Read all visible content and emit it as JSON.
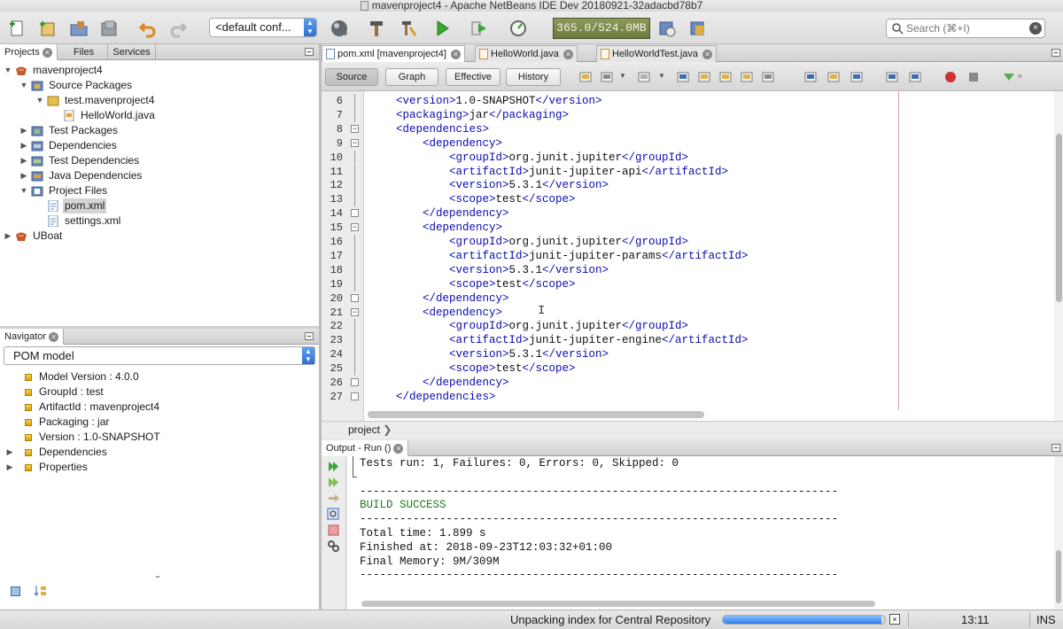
{
  "window": {
    "title": "mavenproject4 - Apache NetBeans IDE Dev 20180921-32adacbd78b7"
  },
  "toolbar": {
    "config_value": "<default conf...",
    "memory_label": "365.0/524.0MB",
    "search_placeholder": "Search (⌘+I)"
  },
  "projects_panel": {
    "tabs": [
      {
        "label": "Projects",
        "active": true
      },
      {
        "label": "Files",
        "active": false
      },
      {
        "label": "Services",
        "active": false
      }
    ],
    "tree": [
      {
        "label": "mavenproject4",
        "level": 0,
        "expanded": true,
        "icon": "maven-project-icon"
      },
      {
        "label": "Source Packages",
        "level": 1,
        "expanded": true,
        "icon": "source-packages-icon"
      },
      {
        "label": "test.mavenproject4",
        "level": 2,
        "expanded": true,
        "icon": "package-icon"
      },
      {
        "label": "HelloWorld.java",
        "level": 3,
        "expanded": null,
        "icon": "java-file-icon"
      },
      {
        "label": "Test Packages",
        "level": 1,
        "expanded": false,
        "icon": "test-packages-icon"
      },
      {
        "label": "Dependencies",
        "level": 1,
        "expanded": false,
        "icon": "dependencies-icon"
      },
      {
        "label": "Test Dependencies",
        "level": 1,
        "expanded": false,
        "icon": "test-dependencies-icon"
      },
      {
        "label": "Java Dependencies",
        "level": 1,
        "expanded": false,
        "icon": "java-dependencies-icon"
      },
      {
        "label": "Project Files",
        "level": 1,
        "expanded": true,
        "icon": "project-files-icon"
      },
      {
        "label": "pom.xml",
        "level": 2,
        "expanded": null,
        "icon": "xml-file-icon",
        "selected": true
      },
      {
        "label": "settings.xml",
        "level": 2,
        "expanded": null,
        "icon": "xml-file-icon"
      },
      {
        "label": "UBoat",
        "level": 0,
        "expanded": false,
        "icon": "maven-project-icon"
      }
    ]
  },
  "navigator": {
    "tab_label": "Navigator",
    "combo_value": "POM model",
    "items": [
      {
        "label": "Model Version : 4.0.0",
        "expandable": false
      },
      {
        "label": "GroupId : test",
        "expandable": false
      },
      {
        "label": "ArtifactId : mavenproject4",
        "expandable": false
      },
      {
        "label": "Packaging : jar",
        "expandable": false
      },
      {
        "label": "Version : 1.0-SNAPSHOT",
        "expandable": false
      },
      {
        "label": "Dependencies",
        "expandable": true
      },
      {
        "label": "Properties",
        "expandable": true
      }
    ]
  },
  "editor_tabs": [
    {
      "label": "pom.xml [mavenproject4]",
      "active": true,
      "type": "xml"
    },
    {
      "label": "HelloWorld.java",
      "active": false,
      "type": "java"
    },
    {
      "label": "HelloWorldTest.java",
      "active": false,
      "type": "java"
    }
  ],
  "editor_view_buttons": [
    {
      "label": "Source",
      "active": true
    },
    {
      "label": "Graph",
      "active": false
    },
    {
      "label": "Effective",
      "active": false
    },
    {
      "label": "History",
      "active": false
    }
  ],
  "editor": {
    "lines": [
      {
        "n": "6",
        "indent": 0,
        "parts": [
          [
            "t",
            "<version>"
          ],
          [
            "x",
            "1.0-SNAPSHOT"
          ],
          [
            "t",
            "</version>"
          ]
        ]
      },
      {
        "n": "7",
        "indent": 0,
        "parts": [
          [
            "t",
            "<packaging>"
          ],
          [
            "x",
            "jar"
          ],
          [
            "t",
            "</packaging>"
          ]
        ]
      },
      {
        "n": "8",
        "indent": 0,
        "parts": [
          [
            "t",
            "<dependencies>"
          ]
        ],
        "fold": "open"
      },
      {
        "n": "9",
        "indent": 1,
        "parts": [
          [
            "t",
            "<dependency>"
          ]
        ],
        "fold": "open"
      },
      {
        "n": "10",
        "indent": 2,
        "parts": [
          [
            "t",
            "<groupId>"
          ],
          [
            "x",
            "org.junit.jupiter"
          ],
          [
            "t",
            "</groupId>"
          ]
        ]
      },
      {
        "n": "11",
        "indent": 2,
        "parts": [
          [
            "t",
            "<artifactId>"
          ],
          [
            "x",
            "junit-jupiter-api"
          ],
          [
            "t",
            "</artifactId>"
          ]
        ]
      },
      {
        "n": "12",
        "indent": 2,
        "parts": [
          [
            "t",
            "<version>"
          ],
          [
            "x",
            "5.3.1"
          ],
          [
            "t",
            "</version>"
          ]
        ]
      },
      {
        "n": "13",
        "indent": 2,
        "parts": [
          [
            "t",
            "<scope>"
          ],
          [
            "x",
            "test"
          ],
          [
            "t",
            "</scope>"
          ]
        ]
      },
      {
        "n": "14",
        "indent": 1,
        "parts": [
          [
            "t",
            "</dependency>"
          ]
        ],
        "fold": "close"
      },
      {
        "n": "15",
        "indent": 1,
        "parts": [
          [
            "t",
            "<dependency>"
          ]
        ],
        "fold": "open"
      },
      {
        "n": "16",
        "indent": 2,
        "parts": [
          [
            "t",
            "<groupId>"
          ],
          [
            "x",
            "org.junit.jupiter"
          ],
          [
            "t",
            "</groupId>"
          ]
        ]
      },
      {
        "n": "17",
        "indent": 2,
        "parts": [
          [
            "t",
            "<artifactId>"
          ],
          [
            "x",
            "junit-jupiter-params"
          ],
          [
            "t",
            "</artifactId>"
          ]
        ]
      },
      {
        "n": "18",
        "indent": 2,
        "parts": [
          [
            "t",
            "<version>"
          ],
          [
            "x",
            "5.3.1"
          ],
          [
            "t",
            "</version>"
          ]
        ]
      },
      {
        "n": "19",
        "indent": 2,
        "parts": [
          [
            "t",
            "<scope>"
          ],
          [
            "x",
            "test"
          ],
          [
            "t",
            "</scope>"
          ]
        ]
      },
      {
        "n": "20",
        "indent": 1,
        "parts": [
          [
            "t",
            "</dependency>"
          ]
        ],
        "fold": "close"
      },
      {
        "n": "21",
        "indent": 1,
        "parts": [
          [
            "t",
            "<dependency>"
          ]
        ],
        "fold": "open"
      },
      {
        "n": "22",
        "indent": 2,
        "parts": [
          [
            "t",
            "<groupId>"
          ],
          [
            "x",
            "org.junit.jupiter"
          ],
          [
            "t",
            "</groupId>"
          ]
        ]
      },
      {
        "n": "23",
        "indent": 2,
        "parts": [
          [
            "t",
            "<artifactId>"
          ],
          [
            "x",
            "junit-jupiter-engine"
          ],
          [
            "t",
            "</artifactId>"
          ]
        ]
      },
      {
        "n": "24",
        "indent": 2,
        "parts": [
          [
            "t",
            "<version>"
          ],
          [
            "x",
            "5.3.1"
          ],
          [
            "t",
            "</version>"
          ]
        ]
      },
      {
        "n": "25",
        "indent": 2,
        "parts": [
          [
            "t",
            "<scope>"
          ],
          [
            "x",
            "test"
          ],
          [
            "t",
            "</scope>"
          ]
        ]
      },
      {
        "n": "26",
        "indent": 1,
        "parts": [
          [
            "t",
            "</dependency>"
          ]
        ],
        "fold": "close"
      },
      {
        "n": "27",
        "indent": 0,
        "parts": [
          [
            "t",
            "</dependencies>"
          ]
        ],
        "fold": "close"
      }
    ]
  },
  "breadcrumb": {
    "label": "project"
  },
  "output": {
    "tab_label": "Output - Run ()",
    "lines": [
      {
        "text": "Tests run: 1, Failures: 0, Errors: 0, Skipped: 0",
        "style": "normal"
      },
      {
        "text": "",
        "style": "normal"
      },
      {
        "text": "------------------------------------------------------------------------",
        "style": "normal"
      },
      {
        "text": "BUILD SUCCESS",
        "style": "green"
      },
      {
        "text": "------------------------------------------------------------------------",
        "style": "normal"
      },
      {
        "text": "Total time: 1.899 s",
        "style": "normal"
      },
      {
        "text": "Finished at: 2018-09-23T12:03:32+01:00",
        "style": "normal"
      },
      {
        "text": "Final Memory: 9M/309M",
        "style": "normal"
      },
      {
        "text": "------------------------------------------------------------------------",
        "style": "normal"
      }
    ]
  },
  "statusbar": {
    "task_text": "Unpacking index for Central Repository",
    "progress": 0.98,
    "cursor_position": "13:11",
    "insert_mode": "INS"
  },
  "colors": {
    "xml_tag": "#0b0bb0",
    "build_success": "#1f7a1f",
    "accent_blue": "#2f6fd8"
  }
}
